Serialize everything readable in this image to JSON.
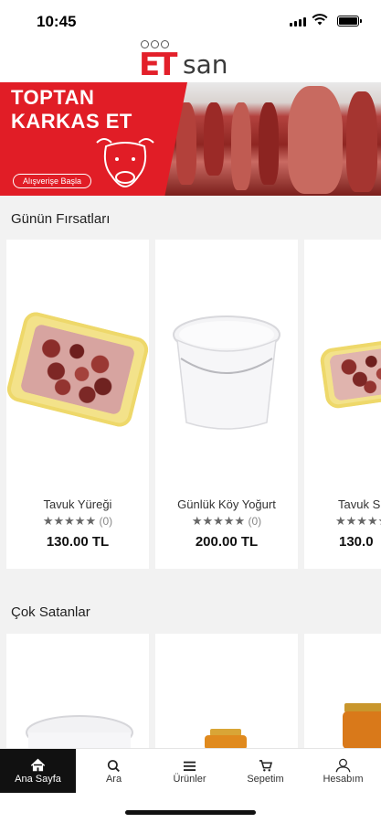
{
  "status_bar": {
    "time": "10:45"
  },
  "header": {
    "logo_text": "ETsan"
  },
  "banner": {
    "title_line1": "TOPTAN",
    "title_line2": "KARKAS ET",
    "cta": "Alışverişe Başla"
  },
  "sections": {
    "deals": {
      "title": "Günün Fırsatları",
      "products": [
        {
          "name": "Tavuk Yüreği",
          "stars": "★★★★★",
          "reviews": "(0)",
          "price": "130.00 TL"
        },
        {
          "name": "Günlük Köy Yoğurt",
          "stars": "★★★★★",
          "reviews": "(0)",
          "price": "200.00 TL"
        },
        {
          "name": "Tavuk S",
          "stars": "★★★★★",
          "reviews": "",
          "price": "130.0"
        }
      ]
    },
    "best_sellers": {
      "title": "Çok Satanlar"
    }
  },
  "tabbar": {
    "items": [
      {
        "label": "Ana Sayfa",
        "icon": "home-icon"
      },
      {
        "label": "Ara",
        "icon": "search-icon"
      },
      {
        "label": "Ürünler",
        "icon": "menu-icon"
      },
      {
        "label": "Sepetim",
        "icon": "cart-icon"
      },
      {
        "label": "Hesabım",
        "icon": "user-icon"
      }
    ]
  },
  "colors": {
    "brand_red": "#e3202a",
    "active_tab_bg": "#111111"
  }
}
